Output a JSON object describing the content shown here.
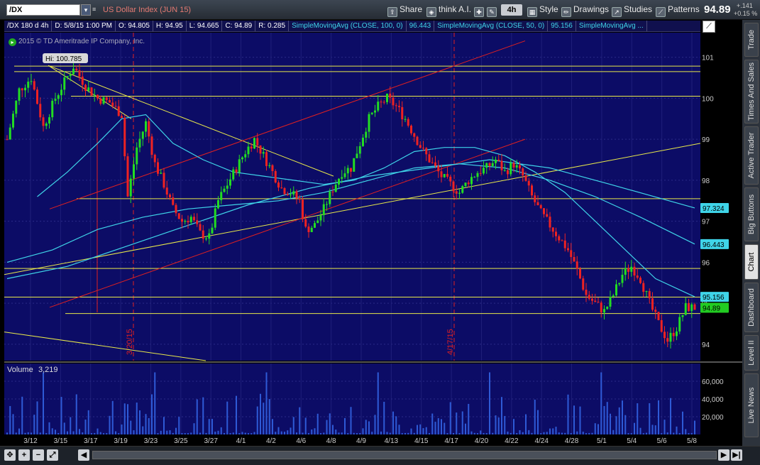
{
  "toolbar": {
    "symbol": "/DX",
    "symbol_description": "US Dollar Index (JUN 15)",
    "share_label": "Share",
    "think_label": "think A.I.",
    "timeframe_label": "4h",
    "style_label": "Style",
    "drawings_label": "Drawings",
    "studies_label": "Studies",
    "patterns_label": "Patterns",
    "last_price": "94.89",
    "change": "+.141",
    "change_pct": "+0.15 %"
  },
  "study_bar": {
    "period": "/DX 180 d 4h",
    "datetime": "D: 5/8/15 1:00 PM",
    "open": "O: 94.805",
    "high": "H: 94.95",
    "low": "L: 94.665",
    "close": "C: 94.89",
    "range": "R: 0.285",
    "sma100_label": "SimpleMovingAvg (CLOSE, 100, 0)",
    "sma100_value": "96.443",
    "sma50_label": "SimpleMovingAvg (CLOSE, 50, 0)",
    "sma50_value": "95.156",
    "sma3_label": "SimpleMovingAvg ..."
  },
  "copyright": "2015 © TD Ameritrade IP Company, Inc.",
  "right_tabs": [
    {
      "label": "Trade",
      "active": false
    },
    {
      "label": "Times And Sales",
      "active": false
    },
    {
      "label": "Active Trader",
      "active": false
    },
    {
      "label": "Big Buttons",
      "active": false
    },
    {
      "label": "Chart",
      "active": true
    },
    {
      "label": "Dashboard",
      "active": false
    },
    {
      "label": "Level II",
      "active": false
    },
    {
      "label": "Live News",
      "active": false
    }
  ],
  "colors": {
    "plot_bg": "#0c0c66",
    "up_candle": "#22dd22",
    "down_candle": "#ee2222",
    "sma": "#3fd4e8",
    "yellow_line": "#e8e84a",
    "red_line": "#e02020"
  },
  "chart_data": {
    "type": "candlestick",
    "title": "US Dollar Index (JUN 15)",
    "price_ticks": [
      "101",
      "100",
      "99",
      "98",
      "97",
      "96",
      "95",
      "94"
    ],
    "ylim": [
      93.6,
      101.6
    ],
    "x_ticks": [
      "3/12",
      "3/15",
      "3/17",
      "3/19",
      "3/23",
      "3/25",
      "3/27",
      "4/1",
      "4/2",
      "4/6",
      "4/8",
      "4/9",
      "4/13",
      "4/15",
      "4/17",
      "4/20",
      "4/22",
      "4/24",
      "4/28",
      "5/1",
      "5/4",
      "5/6",
      "5/8"
    ],
    "high_annotation": "Hi: 100.785",
    "vertical_markers": [
      "3/20/15",
      "4/17/15"
    ],
    "price_bubbles": [
      {
        "label": "97.324",
        "value": 97.324,
        "color": "#3fd4e8"
      },
      {
        "label": "96.443",
        "value": 96.443,
        "color": "#3fd4e8"
      },
      {
        "label": "95.156",
        "value": 95.156,
        "color": "#3fd4e8"
      },
      {
        "label": "94.89",
        "value": 94.89,
        "color": "#22cc22"
      }
    ],
    "horizontal_levels": [
      100.785,
      100.65,
      100.05,
      97.55,
      95.85,
      95.15,
      94.75
    ],
    "close_path": [
      [
        0,
        99.0
      ],
      [
        4,
        100.2
      ],
      [
        8,
        100.5
      ],
      [
        12,
        99.3
      ],
      [
        16,
        100.0
      ],
      [
        19,
        100.4
      ],
      [
        22,
        100.78
      ],
      [
        26,
        100.3
      ],
      [
        30,
        100.0
      ],
      [
        34,
        99.9
      ],
      [
        38,
        99.6
      ],
      [
        40,
        97.6
      ],
      [
        43,
        98.8
      ],
      [
        46,
        99.4
      ],
      [
        49,
        98.4
      ],
      [
        52,
        97.9
      ],
      [
        55,
        97.3
      ],
      [
        58,
        97.0
      ],
      [
        61,
        97.1
      ],
      [
        64,
        96.7
      ],
      [
        67,
        96.6
      ],
      [
        70,
        97.5
      ],
      [
        73,
        97.9
      ],
      [
        76,
        98.3
      ],
      [
        79,
        98.7
      ],
      [
        82,
        99.0
      ],
      [
        85,
        98.6
      ],
      [
        88,
        98.2
      ],
      [
        91,
        97.8
      ],
      [
        94,
        97.7
      ],
      [
        97,
        97.5
      ],
      [
        99,
        96.8
      ],
      [
        102,
        96.9
      ],
      [
        105,
        97.3
      ],
      [
        108,
        97.8
      ],
      [
        111,
        98.2
      ],
      [
        114,
        98.3
      ],
      [
        117,
        98.9
      ],
      [
        120,
        99.5
      ],
      [
        123,
        99.8
      ],
      [
        126,
        100.0
      ],
      [
        129,
        99.8
      ],
      [
        132,
        99.5
      ],
      [
        135,
        99.1
      ],
      [
        138,
        98.7
      ],
      [
        141,
        98.4
      ],
      [
        144,
        98.1
      ],
      [
        147,
        97.9
      ],
      [
        150,
        97.7
      ],
      [
        153,
        98.0
      ],
      [
        156,
        98.2
      ],
      [
        159,
        98.3
      ],
      [
        162,
        98.5
      ],
      [
        165,
        98.2
      ],
      [
        168,
        98.4
      ],
      [
        171,
        98.1
      ],
      [
        174,
        97.6
      ],
      [
        177,
        97.2
      ],
      [
        180,
        96.9
      ],
      [
        183,
        96.6
      ],
      [
        186,
        96.3
      ],
      [
        189,
        95.8
      ],
      [
        192,
        95.2
      ],
      [
        195,
        95.0
      ],
      [
        198,
        94.8
      ],
      [
        201,
        95.2
      ],
      [
        204,
        95.7
      ],
      [
        207,
        95.9
      ],
      [
        210,
        95.6
      ],
      [
        213,
        95.0
      ],
      [
        216,
        94.5
      ],
      [
        219,
        94.1
      ],
      [
        222,
        94.4
      ],
      [
        225,
        94.9
      ],
      [
        228,
        94.89
      ]
    ],
    "sma50": [
      [
        10,
        97.6
      ],
      [
        20,
        98.2
      ],
      [
        30,
        98.9
      ],
      [
        38,
        99.5
      ],
      [
        46,
        99.6
      ],
      [
        55,
        98.9
      ],
      [
        65,
        98.5
      ],
      [
        75,
        98.2
      ],
      [
        85,
        98.1
      ],
      [
        95,
        98.0
      ],
      [
        105,
        97.9
      ],
      [
        115,
        98.0
      ],
      [
        125,
        98.3
      ],
      [
        135,
        98.7
      ],
      [
        145,
        98.8
      ],
      [
        155,
        98.8
      ],
      [
        165,
        98.6
      ],
      [
        175,
        98.2
      ],
      [
        185,
        97.7
      ],
      [
        195,
        97.0
      ],
      [
        205,
        96.3
      ],
      [
        215,
        95.6
      ],
      [
        228,
        95.156
      ]
    ],
    "sma100": [
      [
        0,
        96.0
      ],
      [
        15,
        96.3
      ],
      [
        30,
        96.8
      ],
      [
        45,
        97.1
      ],
      [
        60,
        97.3
      ],
      [
        75,
        97.4
      ],
      [
        90,
        97.5
      ],
      [
        105,
        97.7
      ],
      [
        120,
        98.0
      ],
      [
        135,
        98.3
      ],
      [
        150,
        98.4
      ],
      [
        165,
        98.3
      ],
      [
        180,
        98.0
      ],
      [
        195,
        97.6
      ],
      [
        210,
        97.1
      ],
      [
        228,
        96.443
      ]
    ],
    "sma_third": [
      [
        0,
        95.6
      ],
      [
        20,
        95.9
      ],
      [
        40,
        96.4
      ],
      [
        60,
        96.9
      ],
      [
        80,
        97.4
      ],
      [
        100,
        97.8
      ],
      [
        120,
        98.1
      ],
      [
        140,
        98.3
      ],
      [
        160,
        98.5
      ],
      [
        180,
        98.3
      ],
      [
        200,
        97.9
      ],
      [
        228,
        97.324
      ]
    ],
    "volume": {
      "label": "Volume",
      "value": "3,219",
      "ticks": [
        "60,000",
        "40,000",
        "20,000"
      ],
      "ylim": [
        0,
        80000
      ]
    }
  }
}
